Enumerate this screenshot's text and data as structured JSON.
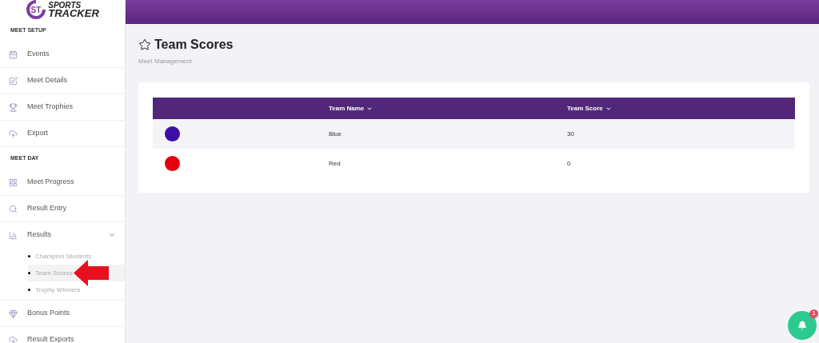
{
  "logo": {
    "mark": "ST",
    "line1": "SPORTS",
    "line2": "TRACKER"
  },
  "sidebar": {
    "sections": [
      {
        "heading": "MEET SETUP",
        "items": [
          {
            "label": "Events"
          },
          {
            "label": "Meet Details"
          },
          {
            "label": "Meet Trophies"
          },
          {
            "label": "Export"
          }
        ]
      },
      {
        "heading": "MEET DAY",
        "items": [
          {
            "label": "Meet Progress"
          },
          {
            "label": "Result Entry"
          },
          {
            "label": "Results",
            "expanded": true,
            "children": [
              {
                "label": "Champion Students",
                "selected": false
              },
              {
                "label": "Team Scores",
                "selected": true
              },
              {
                "label": "Trophy Winners",
                "selected": false
              }
            ]
          },
          {
            "label": "Bonus Points"
          },
          {
            "label": "Result Exports"
          }
        ]
      }
    ]
  },
  "page": {
    "title": "Team Scores",
    "subtitle": "Meet Management"
  },
  "table": {
    "columns": [
      "Team Name",
      "Team Score"
    ],
    "rows": [
      {
        "color": "#3d0ea5",
        "name": "Blue",
        "score": "30"
      },
      {
        "color": "#e3000f",
        "name": "Red",
        "score": "0"
      }
    ]
  },
  "notifications": {
    "count": "1"
  }
}
